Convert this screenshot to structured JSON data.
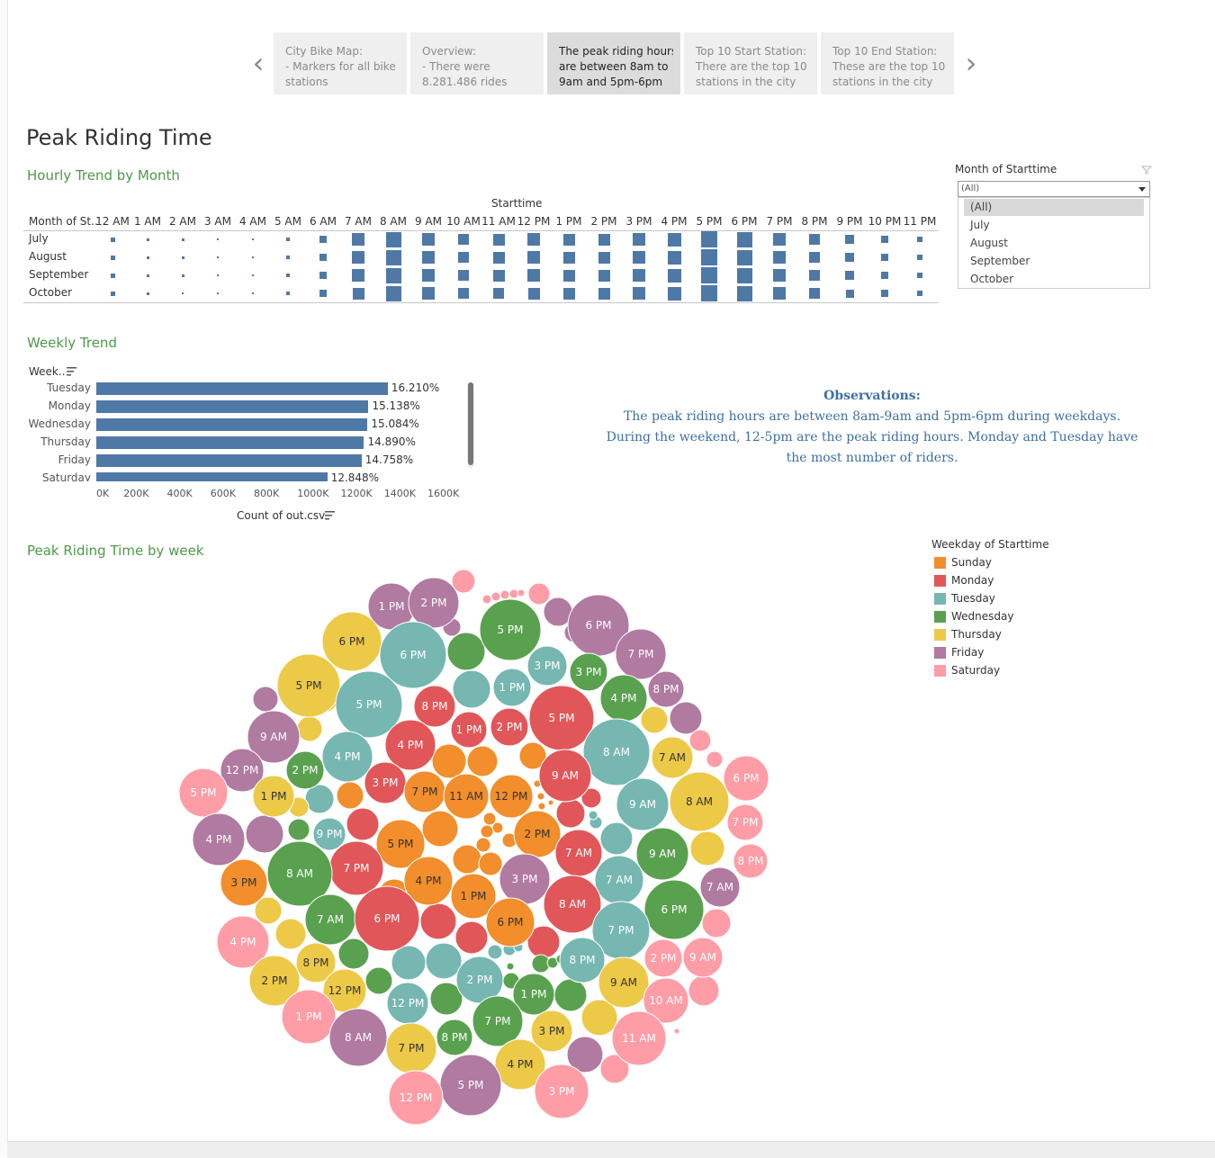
{
  "story": {
    "points": [
      {
        "lines": [
          "City Bike Map:",
          "- Markers for all bike",
          "stations"
        ],
        "active": false
      },
      {
        "lines": [
          "Overview:",
          "- There were",
          "8.281.486 rides"
        ],
        "active": false
      },
      {
        "lines": [
          "The peak riding hours",
          "are between 8am to",
          "9am and 5pm-6pm"
        ],
        "active": true
      },
      {
        "lines": [
          "Top 10 Start Station:",
          "There are the top 10",
          "stations in the city"
        ],
        "active": false
      },
      {
        "lines": [
          "Top 10 End Station:",
          "These are the top 10",
          "stations in the city"
        ],
        "active": false
      }
    ]
  },
  "page_title": "Peak Riding Time",
  "hourly": {
    "title": "Hourly Trend by Month",
    "column_header": "Starttime",
    "row_header": "Month of St..",
    "hours": [
      "12 AM",
      "1 AM",
      "2 AM",
      "3 AM",
      "4 AM",
      "5 AM",
      "6 AM",
      "7 AM",
      "8 AM",
      "9 AM",
      "10 AM",
      "11 AM",
      "12 PM",
      "1 PM",
      "2 PM",
      "3 PM",
      "4 PM",
      "5 PM",
      "6 PM",
      "7 PM",
      "8 PM",
      "9 PM",
      "10 PM",
      "11 PM"
    ],
    "months": [
      "July",
      "August",
      "September",
      "October"
    ],
    "marks": [
      [
        0.28,
        0.19,
        0.14,
        0.1,
        0.11,
        0.22,
        0.47,
        0.75,
        0.97,
        0.79,
        0.65,
        0.7,
        0.75,
        0.74,
        0.74,
        0.76,
        0.86,
        1.0,
        0.95,
        0.8,
        0.65,
        0.53,
        0.44,
        0.35
      ],
      [
        0.28,
        0.19,
        0.14,
        0.1,
        0.11,
        0.22,
        0.47,
        0.75,
        0.97,
        0.79,
        0.65,
        0.7,
        0.75,
        0.74,
        0.74,
        0.76,
        0.86,
        1.0,
        0.95,
        0.8,
        0.65,
        0.53,
        0.44,
        0.35
      ],
      [
        0.28,
        0.19,
        0.14,
        0.1,
        0.11,
        0.22,
        0.47,
        0.75,
        0.97,
        0.79,
        0.65,
        0.7,
        0.75,
        0.74,
        0.74,
        0.76,
        0.86,
        1.0,
        0.95,
        0.8,
        0.65,
        0.53,
        0.44,
        0.35
      ],
      [
        0.26,
        0.18,
        0.13,
        0.09,
        0.1,
        0.21,
        0.46,
        0.74,
        0.96,
        0.78,
        0.64,
        0.69,
        0.74,
        0.73,
        0.73,
        0.75,
        0.85,
        1.0,
        0.94,
        0.79,
        0.64,
        0.52,
        0.43,
        0.34
      ]
    ]
  },
  "filter": {
    "label": "Month of Starttime",
    "selected": "(All)",
    "options": [
      "(All)",
      "July",
      "August",
      "September",
      "October"
    ]
  },
  "weekly": {
    "title": "Weekly Trend",
    "axis_header": "Week..",
    "xlabel": "Count of out.csv",
    "ticks": [
      "0K",
      "200K",
      "400K",
      "600K",
      "800K",
      "1000K",
      "1200K",
      "1400K",
      "1600K"
    ],
    "chart_data": {
      "type": "bar",
      "orientation": "horizontal",
      "categories": [
        "Tuesday",
        "Monday",
        "Wednesday",
        "Thursday",
        "Friday",
        "Saturday"
      ],
      "values": [
        1342400,
        1253650,
        1249180,
        1233100,
        1221800,
        1064050
      ],
      "labels": [
        "16.210%",
        "15.138%",
        "15.084%",
        "14.890%",
        "14.758%",
        "12.848%"
      ],
      "xlim": [
        0,
        1600000
      ],
      "xlabel": "Count of out.csv"
    }
  },
  "observations": {
    "heading": "Observations:",
    "body": "The peak riding hours are between 8am-9am and 5pm-6pm during weekdays. During the weekend, 12-5pm are the peak riding hours. Monday and Tuesday have the most number of riders."
  },
  "bubble": {
    "title": "Peak Riding Time by week",
    "legend_title": "Weekday of Starttime",
    "legend": [
      {
        "name": "Sunday",
        "color": "#f28e2b"
      },
      {
        "name": "Monday",
        "color": "#e15759"
      },
      {
        "name": "Tuesday",
        "color": "#76b7b2"
      },
      {
        "name": "Wednesday",
        "color": "#59a14f"
      },
      {
        "name": "Thursday",
        "color": "#edc948"
      },
      {
        "name": "Friday",
        "color": "#b07aa1"
      },
      {
        "name": "Saturday",
        "color": "#ff9da7"
      }
    ],
    "labeled": [
      {
        "label": "1 PM",
        "day": "Friday"
      },
      {
        "label": "2 PM",
        "day": "Friday"
      },
      {
        "label": "5 PM",
        "day": "Wednesday"
      },
      {
        "label": "6 PM",
        "day": "Friday"
      },
      {
        "label": "6 PM",
        "day": "Thursday"
      },
      {
        "label": "6 PM",
        "day": "Tuesday"
      },
      {
        "label": "7 PM",
        "day": "Friday"
      },
      {
        "label": "3 PM",
        "day": "Tuesday"
      },
      {
        "label": "3 PM",
        "day": "Wednesday"
      },
      {
        "label": "5 PM",
        "day": "Thursday"
      },
      {
        "label": "5 PM",
        "day": "Tuesday"
      },
      {
        "label": "1 PM",
        "day": "Tuesday"
      },
      {
        "label": "4 PM",
        "day": "Wednesday"
      },
      {
        "label": "8 PM",
        "day": "Friday"
      },
      {
        "label": "8 PM",
        "day": "Monday"
      },
      {
        "label": "5 PM",
        "day": "Monday"
      },
      {
        "label": "9 AM",
        "day": "Friday"
      },
      {
        "label": "1 PM",
        "day": "Monday"
      },
      {
        "label": "2 PM",
        "day": "Monday"
      },
      {
        "label": "4 PM",
        "day": "Monday"
      },
      {
        "label": "4 PM",
        "day": "Tuesday"
      },
      {
        "label": "8 AM",
        "day": "Tuesday"
      },
      {
        "label": "7 AM",
        "day": "Thursday"
      },
      {
        "label": "12 PM",
        "day": "Friday"
      },
      {
        "label": "2 PM",
        "day": "Wednesday"
      },
      {
        "label": "6 PM",
        "day": "Saturday"
      },
      {
        "label": "5 PM",
        "day": "Saturday"
      },
      {
        "label": "1 PM",
        "day": "Thursday"
      },
      {
        "label": "3 PM",
        "day": "Monday"
      },
      {
        "label": "7 PM",
        "day": "Sunday"
      },
      {
        "label": "11 AM",
        "day": "Sunday"
      },
      {
        "label": "12 PM",
        "day": "Sunday"
      },
      {
        "label": "9 AM",
        "day": "Monday"
      },
      {
        "label": "9 AM",
        "day": "Tuesday"
      },
      {
        "label": "8 AM",
        "day": "Thursday"
      },
      {
        "label": "9 PM",
        "day": "Tuesday"
      },
      {
        "label": "4 PM",
        "day": "Friday"
      },
      {
        "label": "5 PM",
        "day": "Sunday"
      },
      {
        "label": "2 PM",
        "day": "Sunday"
      },
      {
        "label": "7 PM",
        "day": "Saturday"
      },
      {
        "label": "7 PM",
        "day": "Monday"
      },
      {
        "label": "7 AM",
        "day": "Monday"
      },
      {
        "label": "9 AM",
        "day": "Wednesday"
      },
      {
        "label": "8 AM",
        "day": "Wednesday"
      },
      {
        "label": "3 PM",
        "day": "Friday"
      },
      {
        "label": "4 PM",
        "day": "Sunday"
      },
      {
        "label": "1 PM",
        "day": "Sunday"
      },
      {
        "label": "3 PM",
        "day": "Sunday"
      },
      {
        "label": "7 AM",
        "day": "Tuesday"
      },
      {
        "label": "8 PM",
        "day": "Saturday"
      },
      {
        "label": "7 AM",
        "day": "Friday"
      },
      {
        "label": "7 AM",
        "day": "Wednesday"
      },
      {
        "label": "6 PM",
        "day": "Monday"
      },
      {
        "label": "8 AM",
        "day": "Monday"
      },
      {
        "label": "6 PM",
        "day": "Sunday"
      },
      {
        "label": "6 PM",
        "day": "Wednesday"
      },
      {
        "label": "4 PM",
        "day": "Saturday"
      },
      {
        "label": "7 PM",
        "day": "Tuesday"
      },
      {
        "label": "8 PM",
        "day": "Thursday"
      },
      {
        "label": "8 PM",
        "day": "Tuesday"
      },
      {
        "label": "2 PM",
        "day": "Thursday"
      },
      {
        "label": "9 AM",
        "day": "Saturday"
      },
      {
        "label": "2 PM",
        "day": "Saturday"
      },
      {
        "label": "12 PM",
        "day": "Thursday"
      },
      {
        "label": "12 PM",
        "day": "Tuesday"
      },
      {
        "label": "2 PM",
        "day": "Tuesday"
      },
      {
        "label": "1 PM",
        "day": "Wednesday"
      },
      {
        "label": "9 AM",
        "day": "Thursday"
      },
      {
        "label": "10 AM",
        "day": "Saturday"
      },
      {
        "label": "1 PM",
        "day": "Saturday"
      },
      {
        "label": "7 PM",
        "day": "Wednesday"
      },
      {
        "label": "3 PM",
        "day": "Thursday"
      },
      {
        "label": "8 AM",
        "day": "Friday"
      },
      {
        "label": "8 PM",
        "day": "Wednesday"
      },
      {
        "label": "7 PM",
        "day": "Thursday"
      },
      {
        "label": "4 PM",
        "day": "Thursday"
      },
      {
        "label": "11 AM",
        "day": "Saturday"
      },
      {
        "label": "5 PM",
        "day": "Friday"
      },
      {
        "label": "3 PM",
        "day": "Saturday"
      },
      {
        "label": "12 PM",
        "day": "Saturday"
      }
    ]
  }
}
